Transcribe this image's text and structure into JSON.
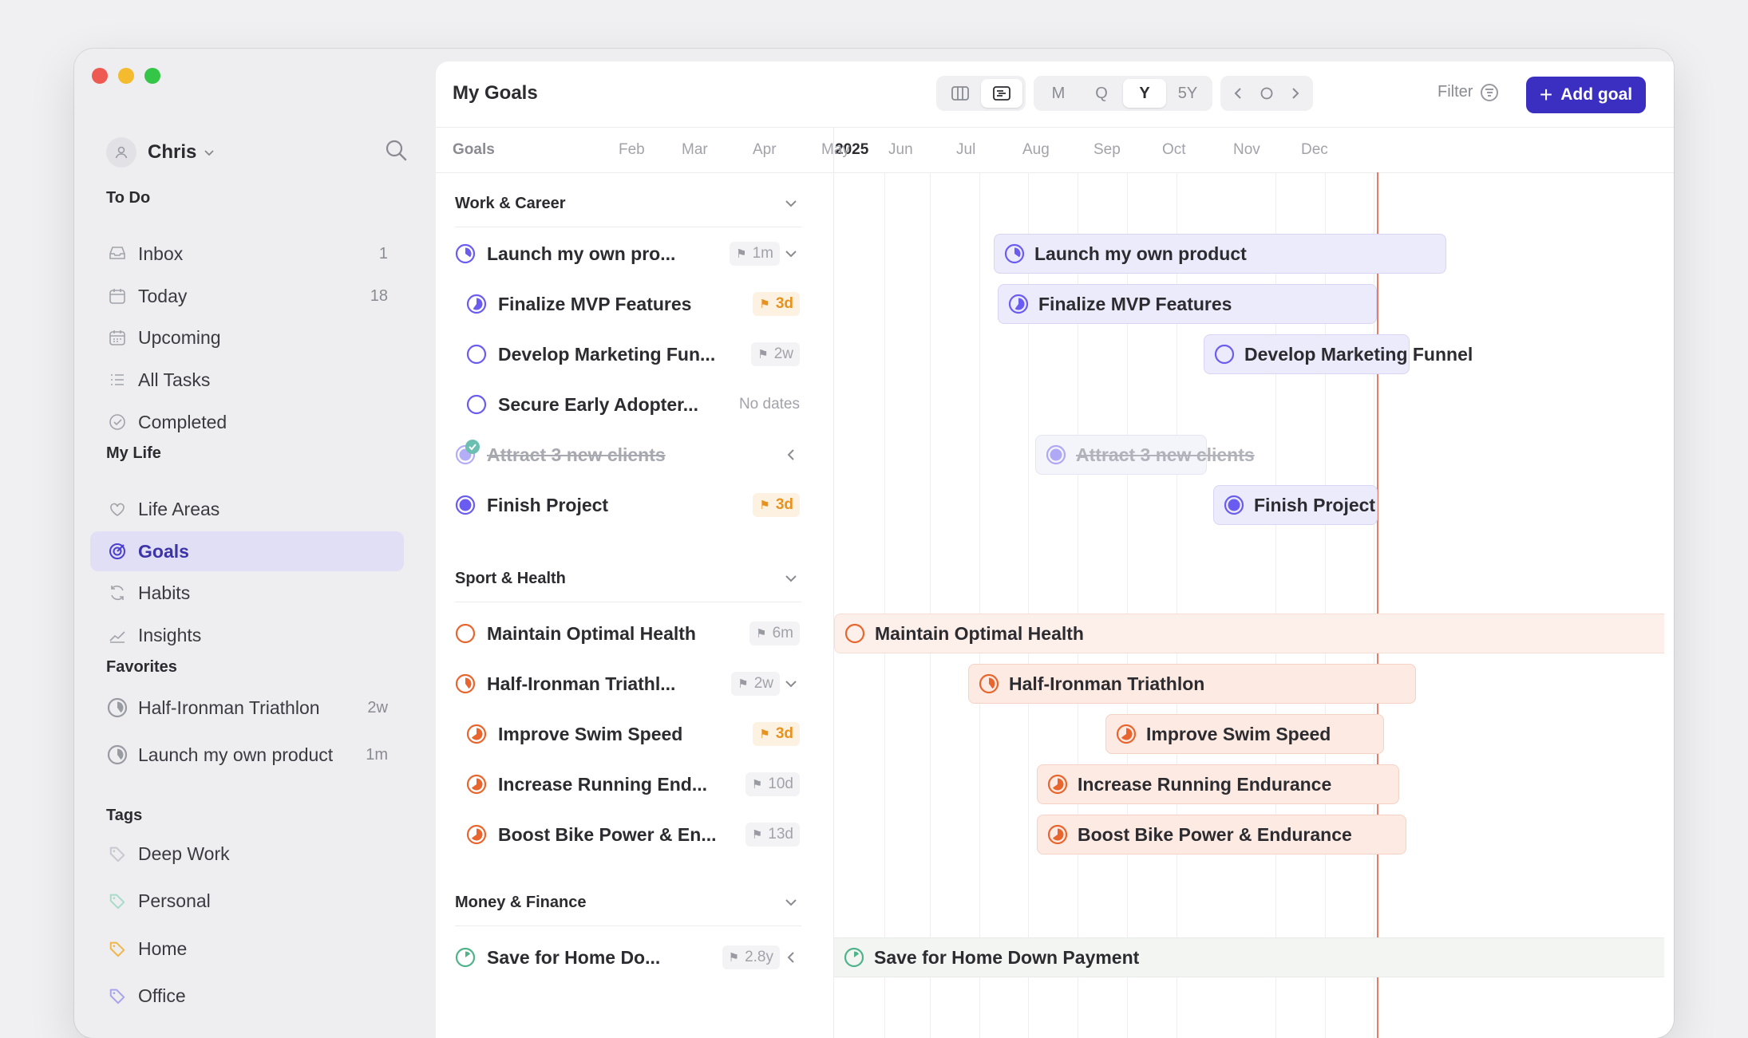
{
  "sidebar": {
    "user": {
      "name": "Chris"
    },
    "todo": {
      "title": "To Do",
      "items": [
        {
          "label": "Inbox",
          "count": "1",
          "icon": "inbox-icon"
        },
        {
          "label": "Today",
          "count": "18",
          "icon": "calendar-icon"
        },
        {
          "label": "Upcoming",
          "count": "",
          "icon": "calendar-grid-icon"
        },
        {
          "label": "All Tasks",
          "count": "",
          "icon": "list-icon"
        },
        {
          "label": "Completed",
          "count": "",
          "icon": "check-circle-icon"
        }
      ]
    },
    "mylife": {
      "title": "My Life",
      "items": [
        {
          "label": "Life Areas",
          "icon": "heart-icon"
        },
        {
          "label": "Goals",
          "icon": "target-icon",
          "active": true
        },
        {
          "label": "Habits",
          "icon": "refresh-icon"
        },
        {
          "label": "Insights",
          "icon": "chart-line-icon"
        }
      ]
    },
    "favorites": {
      "title": "Favorites",
      "items": [
        {
          "label": "Half-Ironman Triathlon",
          "count": "2w"
        },
        {
          "label": "Launch my own product",
          "count": "1m"
        }
      ]
    },
    "tags": {
      "title": "Tags",
      "items": [
        {
          "label": "Deep Work",
          "color": "#c8c8d0"
        },
        {
          "label": "Personal",
          "color": "#a8dcc8"
        },
        {
          "label": "Home",
          "color": "#f0b64a"
        },
        {
          "label": "Office",
          "color": "#a8a4ec"
        }
      ]
    }
  },
  "header": {
    "title": "My Goals",
    "ranges": [
      "M",
      "Q",
      "Y",
      "5Y"
    ],
    "selected_range": "Y",
    "filter_label": "Filter",
    "add_goal_label": "Add goal"
  },
  "timeline_header": {
    "goals_label": "Goals",
    "year": "2025",
    "months": [
      "Feb",
      "Mar",
      "Apr",
      "May",
      "Jun",
      "Jul",
      "Aug",
      "Sep",
      "Oct",
      "Nov",
      "Dec"
    ]
  },
  "groups": [
    {
      "title": "Work & Career",
      "color": "#6a5cf0",
      "goals": [
        {
          "name": "Launch my own pro...",
          "bar_name": "Launch my own product",
          "badge": "1m",
          "urgent": false,
          "progress": 0.35,
          "chevron": "down"
        },
        {
          "name": "Finalize MVP Features",
          "bar_name": "Finalize MVP Features",
          "badge": "3d",
          "urgent": true,
          "progress": 0.6
        },
        {
          "name": "Develop Marketing Fun...",
          "bar_name": "Develop Marketing Funnel",
          "badge": "2w",
          "urgent": false,
          "progress": 0
        },
        {
          "name": "Secure Early Adopter...",
          "badge_text": "No dates",
          "progress": 0
        },
        {
          "name": "Attract 3 new clients",
          "bar_name": "Attract 3 new clients",
          "done": true,
          "progress": 1,
          "chevron": "left"
        },
        {
          "name": "Finish Project",
          "bar_name": "Finish Project",
          "badge": "3d",
          "urgent": true,
          "progress": 1
        }
      ]
    },
    {
      "title": "Sport & Health",
      "color": "#e8652e",
      "goals": [
        {
          "name": "Maintain Optimal Health",
          "bar_name": "Maintain Optimal Health",
          "badge": "6m",
          "urgent": false,
          "progress": 0
        },
        {
          "name": "Half-Ironman Triathl...",
          "bar_name": "Half-Ironman Triathlon",
          "badge": "2w",
          "urgent": false,
          "progress": 0.4,
          "chevron": "down"
        },
        {
          "name": "Improve Swim Speed",
          "bar_name": "Improve Swim Speed",
          "badge": "3d",
          "urgent": true,
          "progress": 0.65
        },
        {
          "name": "Increase Running End...",
          "bar_name": "Increase Running Endurance",
          "badge": "10d",
          "urgent": false,
          "progress": 0.65
        },
        {
          "name": "Boost Bike Power & En...",
          "bar_name": "Boost Bike Power & Endurance",
          "badge": "13d",
          "urgent": false,
          "progress": 0.65
        }
      ]
    },
    {
      "title": "Money & Finance",
      "color": "#4fb38a",
      "goals": [
        {
          "name": "Save for Home Do...",
          "bar_name": "Save for Home Down Payment",
          "badge": "2.8y",
          "urgent": false,
          "progress": 0.15,
          "chevron": "left"
        }
      ]
    }
  ]
}
